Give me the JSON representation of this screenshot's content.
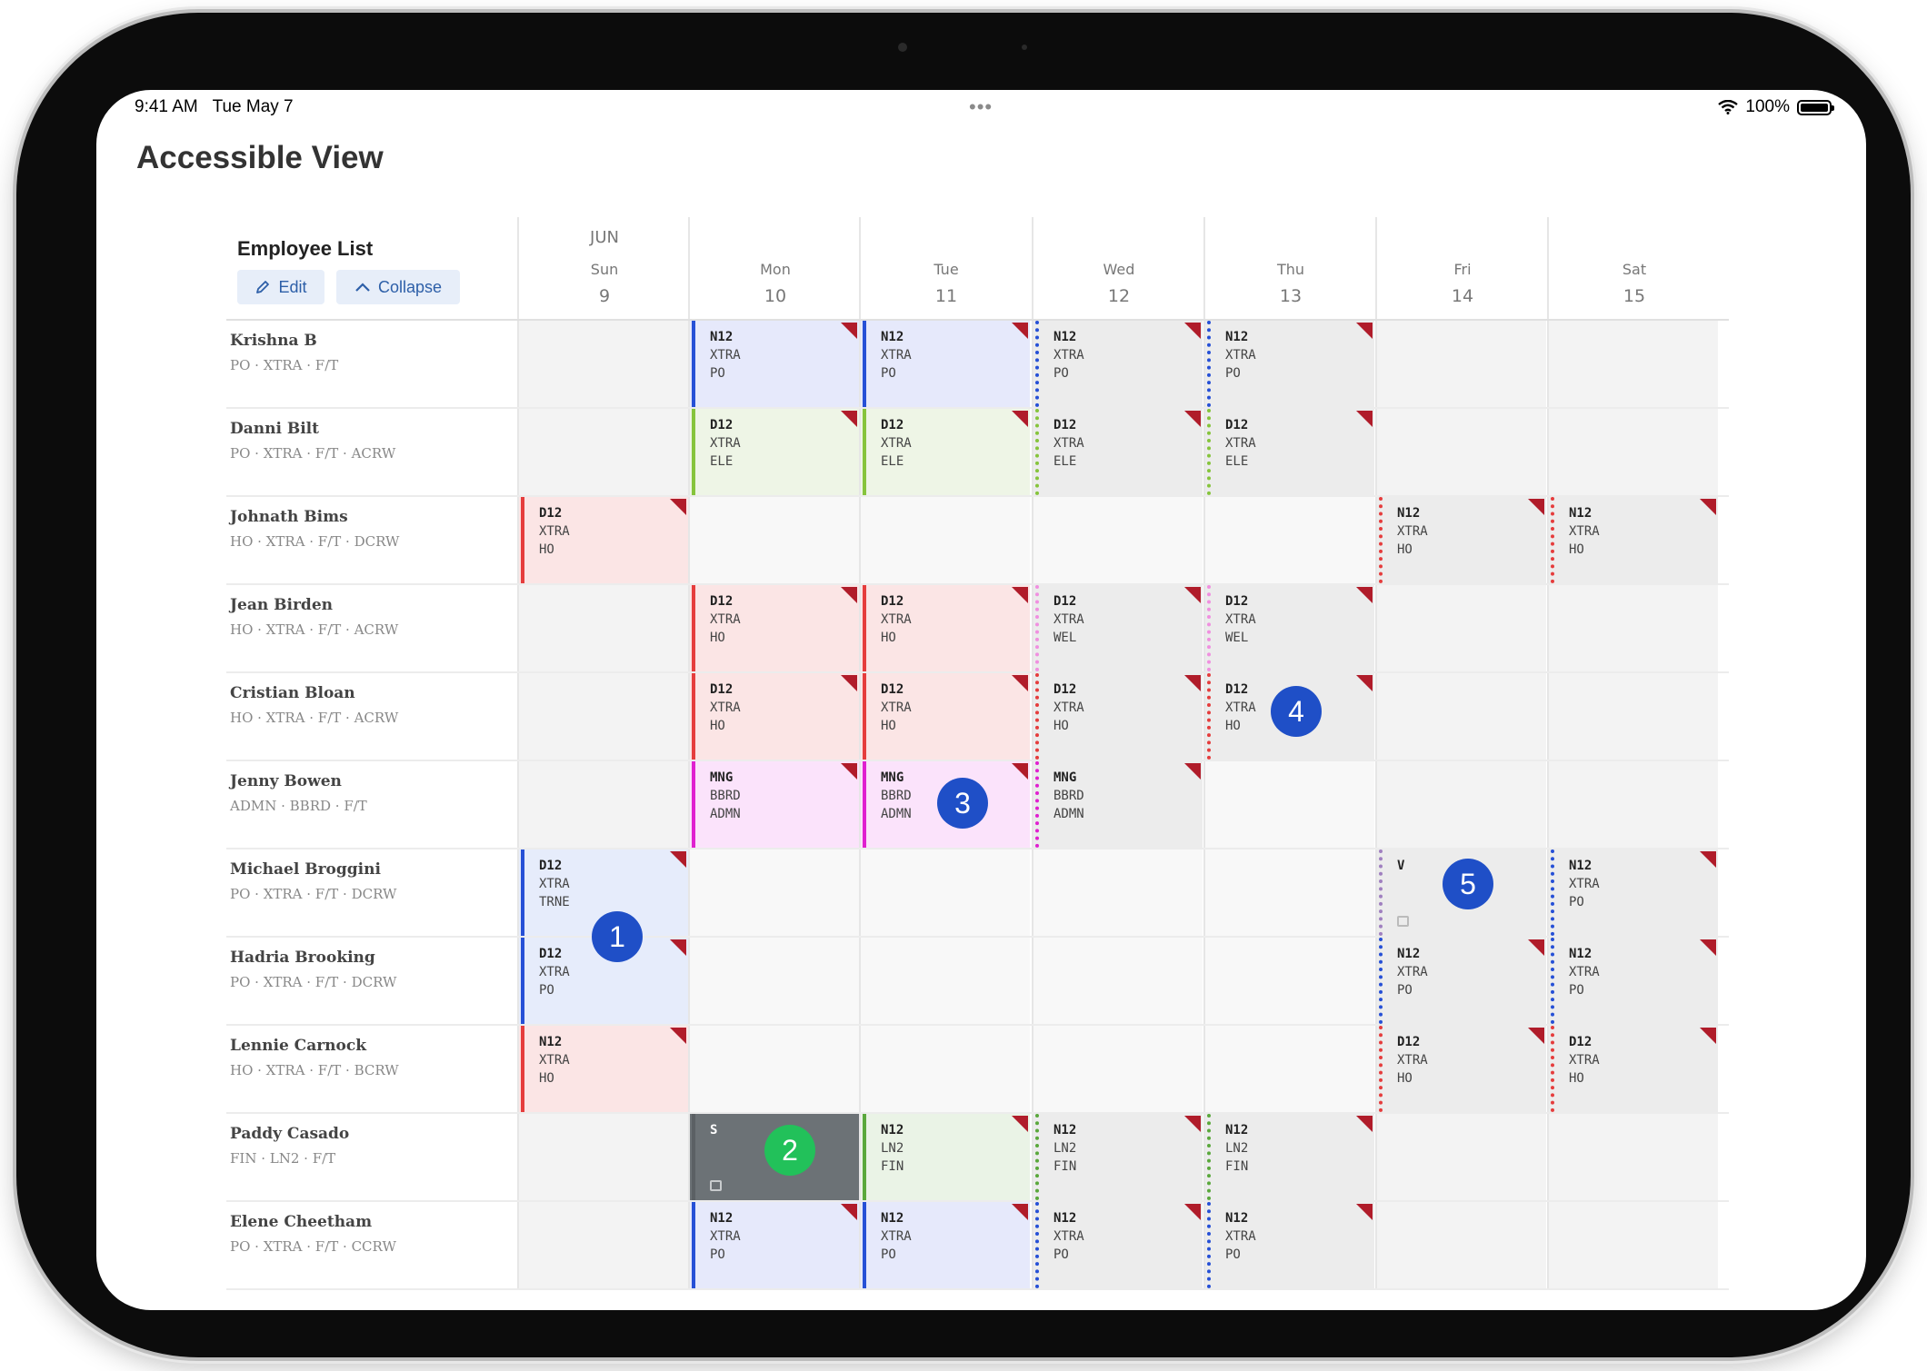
{
  "status_bar": {
    "time": "9:41 AM",
    "date": "Tue May 7",
    "dots": "•••",
    "battery": "100%"
  },
  "page": {
    "title": "Accessible View"
  },
  "employee_panel": {
    "title": "Employee List",
    "edit_label": "Edit",
    "collapse_label": "Collapse"
  },
  "month_label": "JUN",
  "days": [
    {
      "dow": "Sun",
      "num": "9"
    },
    {
      "dow": "Mon",
      "num": "10"
    },
    {
      "dow": "Tue",
      "num": "11"
    },
    {
      "dow": "Wed",
      "num": "12"
    },
    {
      "dow": "Thu",
      "num": "13"
    },
    {
      "dow": "Fri",
      "num": "14"
    },
    {
      "dow": "Sat",
      "num": "15"
    }
  ],
  "colors": {
    "cell_default": "#f3f3f3",
    "cell_empty": "#f8f8f8",
    "flag": "#b01c2a",
    "badge_blue": "#1f4fc7",
    "badge_green": "#22c15a",
    "shift_off": "#6c7276"
  },
  "employees": [
    {
      "name": "Krishna B",
      "meta": "PO · XTRA · F/T",
      "shifts": [
        null,
        {
          "code": "N12",
          "l2": "XTRA",
          "l3": "PO",
          "bg": "#e6e9fb",
          "bar": "#2650d6",
          "style": "solid",
          "flag": true
        },
        {
          "code": "N12",
          "l2": "XTRA",
          "l3": "PO",
          "bg": "#e6e9fb",
          "bar": "#2650d6",
          "style": "solid",
          "flag": true
        },
        {
          "code": "N12",
          "l2": "XTRA",
          "l3": "PO",
          "bg": "#ececec",
          "bar": "#2650d6",
          "style": "dotted",
          "flag": true
        },
        {
          "code": "N12",
          "l2": "XTRA",
          "l3": "PO",
          "bg": "#ececec",
          "bar": "#2650d6",
          "style": "dotted",
          "flag": true
        },
        null,
        null
      ]
    },
    {
      "name": "Danni Bilt",
      "meta": "PO · XTRA · F/T · ACRW",
      "shifts": [
        null,
        {
          "code": "D12",
          "l2": "XTRA",
          "l3": "ELE",
          "bg": "#eef5e6",
          "bar": "#86c43c",
          "style": "solid",
          "flag": true
        },
        {
          "code": "D12",
          "l2": "XTRA",
          "l3": "ELE",
          "bg": "#eef5e6",
          "bar": "#86c43c",
          "style": "solid",
          "flag": true
        },
        {
          "code": "D12",
          "l2": "XTRA",
          "l3": "ELE",
          "bg": "#ececec",
          "bar": "#86c43c",
          "style": "dotted",
          "flag": true
        },
        {
          "code": "D12",
          "l2": "XTRA",
          "l3": "ELE",
          "bg": "#ececec",
          "bar": "#86c43c",
          "style": "dotted",
          "flag": true
        },
        null,
        null
      ]
    },
    {
      "name": "Johnath Bims",
      "meta": "HO · XTRA · F/T · DCRW",
      "shifts": [
        {
          "code": "D12",
          "l2": "XTRA",
          "l3": "HO",
          "bg": "#fbe5e5",
          "bar": "#e53d3d",
          "style": "solid",
          "flag": true
        },
        null,
        null,
        null,
        null,
        {
          "code": "N12",
          "l2": "XTRA",
          "l3": "HO",
          "bg": "#ececec",
          "bar": "#e53d3d",
          "style": "dotted",
          "flag": true
        },
        {
          "code": "N12",
          "l2": "XTRA",
          "l3": "HO",
          "bg": "#ececec",
          "bar": "#e53d3d",
          "style": "dotted",
          "flag": true
        }
      ]
    },
    {
      "name": "Jean Birden",
      "meta": "HO · XTRA · F/T · ACRW",
      "shifts": [
        null,
        {
          "code": "D12",
          "l2": "XTRA",
          "l3": "HO",
          "bg": "#fbe5e5",
          "bar": "#e53d3d",
          "style": "solid",
          "flag": true
        },
        {
          "code": "D12",
          "l2": "XTRA",
          "l3": "HO",
          "bg": "#fbe5e5",
          "bar": "#e53d3d",
          "style": "solid",
          "flag": true
        },
        {
          "code": "D12",
          "l2": "XTRA",
          "l3": "WEL",
          "bg": "#ececec",
          "bar": "#f090e0",
          "style": "dotted",
          "flag": true
        },
        {
          "code": "D12",
          "l2": "XTRA",
          "l3": "WEL",
          "bg": "#ececec",
          "bar": "#f090e0",
          "style": "dotted",
          "flag": true
        },
        null,
        null
      ]
    },
    {
      "name": "Cristian Bloan",
      "meta": "HO · XTRA · F/T · ACRW",
      "shifts": [
        null,
        {
          "code": "D12",
          "l2": "XTRA",
          "l3": "HO",
          "bg": "#fbe5e5",
          "bar": "#e53d3d",
          "style": "solid",
          "flag": true
        },
        {
          "code": "D12",
          "l2": "XTRA",
          "l3": "HO",
          "bg": "#fbe5e5",
          "bar": "#e53d3d",
          "style": "solid",
          "flag": true
        },
        {
          "code": "D12",
          "l2": "XTRA",
          "l3": "HO",
          "bg": "#ececec",
          "bar": "#e53d3d",
          "style": "dotted",
          "flag": true
        },
        {
          "code": "D12",
          "l2": "XTRA",
          "l3": "HO",
          "bg": "#ececec",
          "bar": "#e53d3d",
          "style": "dotted",
          "flag": true
        },
        null,
        null
      ]
    },
    {
      "name": "Jenny Bowen",
      "meta": "ADMN · BBRD · F/T",
      "shifts": [
        null,
        {
          "code": "MNG",
          "l2": "BBRD",
          "l3": "ADMN",
          "bg": "#fbe3fb",
          "bar": "#e020d0",
          "style": "solid",
          "flag": true
        },
        {
          "code": "MNG",
          "l2": "BBRD",
          "l3": "ADMN",
          "bg": "#fbe3fb",
          "bar": "#e020d0",
          "style": "solid",
          "flag": true
        },
        {
          "code": "MNG",
          "l2": "BBRD",
          "l3": "ADMN",
          "bg": "#ececec",
          "bar": "#e020d0",
          "style": "dotted",
          "flag": true
        },
        null,
        null,
        null
      ]
    },
    {
      "name": "Michael Broggini",
      "meta": "PO · XTRA · F/T · DCRW",
      "shifts": [
        {
          "code": "D12",
          "l2": "XTRA",
          "l3": "TRNE",
          "bg": "#e6ecfb",
          "bar": "#2650d6",
          "style": "solid",
          "flag": true
        },
        null,
        null,
        null,
        null,
        {
          "code": "V",
          "l2": "",
          "l3": "",
          "bg": "#ececec",
          "bar": "#a080c0",
          "style": "dotted",
          "flag": false,
          "icon": true
        },
        {
          "code": "N12",
          "l2": "XTRA",
          "l3": "PO",
          "bg": "#ececec",
          "bar": "#2650d6",
          "style": "dotted",
          "flag": true
        }
      ]
    },
    {
      "name": "Hadria Brooking",
      "meta": "PO · XTRA · F/T · DCRW",
      "shifts": [
        {
          "code": "D12",
          "l2": "XTRA",
          "l3": "PO",
          "bg": "#e6ecfb",
          "bar": "#2650d6",
          "style": "solid",
          "flag": true
        },
        null,
        null,
        null,
        null,
        {
          "code": "N12",
          "l2": "XTRA",
          "l3": "PO",
          "bg": "#ececec",
          "bar": "#2650d6",
          "style": "dotted",
          "flag": true
        },
        {
          "code": "N12",
          "l2": "XTRA",
          "l3": "PO",
          "bg": "#ececec",
          "bar": "#2650d6",
          "style": "dotted",
          "flag": true
        }
      ]
    },
    {
      "name": "Lennie Carnock",
      "meta": "HO · XTRA · F/T · BCRW",
      "shifts": [
        {
          "code": "N12",
          "l2": "XTRA",
          "l3": "HO",
          "bg": "#fbe5e5",
          "bar": "#e53d3d",
          "style": "solid",
          "flag": true
        },
        null,
        null,
        null,
        null,
        {
          "code": "D12",
          "l2": "XTRA",
          "l3": "HO",
          "bg": "#ececec",
          "bar": "#e53d3d",
          "style": "dotted",
          "flag": true
        },
        {
          "code": "D12",
          "l2": "XTRA",
          "l3": "HO",
          "bg": "#ececec",
          "bar": "#e53d3d",
          "style": "dotted",
          "flag": true
        }
      ]
    },
    {
      "name": "Paddy Casado",
      "meta": "FIN · LN2 · F/T",
      "shifts": [
        null,
        {
          "code": "S",
          "l2": "",
          "l3": "",
          "bg": "#6c7276",
          "bar": "#5b6064",
          "style": "solid",
          "flag": false,
          "dark": true,
          "icon": true
        },
        {
          "code": "N12",
          "l2": "LN2",
          "l3": "FIN",
          "bg": "#eaf3e6",
          "bar": "#5aa83c",
          "style": "solid",
          "flag": true
        },
        {
          "code": "N12",
          "l2": "LN2",
          "l3": "FIN",
          "bg": "#ececec",
          "bar": "#5aa83c",
          "style": "dotted",
          "flag": true
        },
        {
          "code": "N12",
          "l2": "LN2",
          "l3": "FIN",
          "bg": "#ececec",
          "bar": "#5aa83c",
          "style": "dotted",
          "flag": true
        },
        null,
        null
      ]
    },
    {
      "name": "Elene Cheetham",
      "meta": "PO · XTRA · F/T · CCRW",
      "shifts": [
        null,
        {
          "code": "N12",
          "l2": "XTRA",
          "l3": "PO",
          "bg": "#e6e9fb",
          "bar": "#2650d6",
          "style": "solid",
          "flag": true
        },
        {
          "code": "N12",
          "l2": "XTRA",
          "l3": "PO",
          "bg": "#e6e9fb",
          "bar": "#2650d6",
          "style": "solid",
          "flag": true
        },
        {
          "code": "N12",
          "l2": "XTRA",
          "l3": "PO",
          "bg": "#ececec",
          "bar": "#2650d6",
          "style": "dotted",
          "flag": true
        },
        {
          "code": "N12",
          "l2": "XTRA",
          "l3": "PO",
          "bg": "#ececec",
          "bar": "#2650d6",
          "style": "dotted",
          "flag": true
        },
        null,
        null
      ]
    }
  ],
  "badges": [
    {
      "label": "1",
      "color": "#1f4fc7"
    },
    {
      "label": "2",
      "color": "#22c15a"
    },
    {
      "label": "3",
      "color": "#1f4fc7"
    },
    {
      "label": "4",
      "color": "#1f4fc7"
    },
    {
      "label": "5",
      "color": "#1f4fc7"
    }
  ]
}
